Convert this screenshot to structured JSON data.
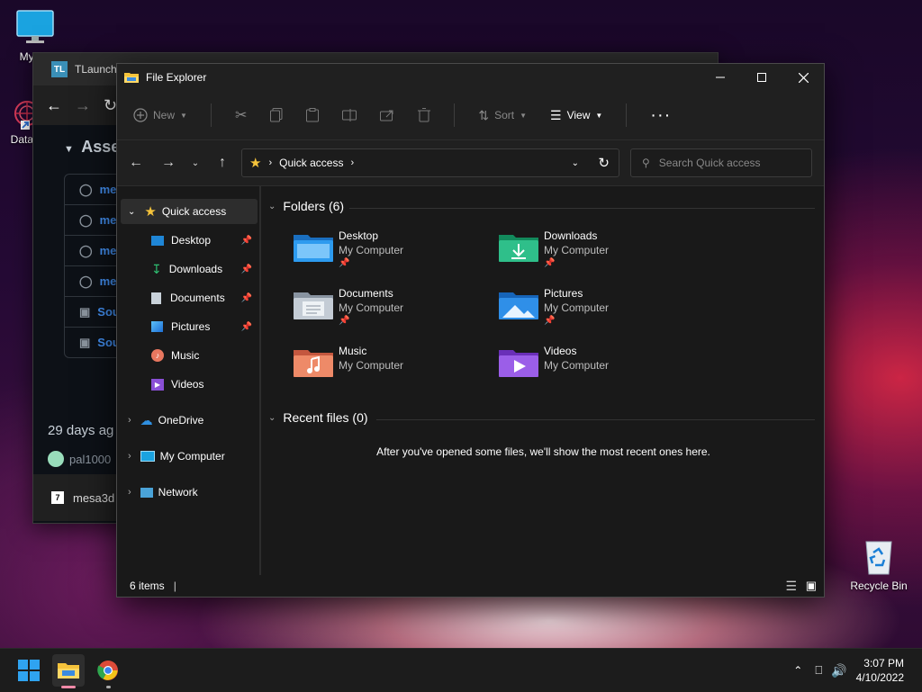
{
  "desktop": {
    "icons": [
      {
        "label": "My Co"
      },
      {
        "label": "DataW"
      },
      {
        "label": "Recycle Bin"
      }
    ]
  },
  "bg_window": {
    "title": "TLaunche",
    "section_title": "Asset",
    "list_items": [
      "me",
      "me",
      "me",
      "me",
      "Sou",
      "Sou"
    ],
    "time_ago": "29 days ag",
    "user": "pal1000",
    "footer_file": "mesa3d"
  },
  "explorer": {
    "title": "File Explorer",
    "toolbar": {
      "new": "New",
      "sort": "Sort",
      "view": "View"
    },
    "address": {
      "location": "Quick access"
    },
    "search": {
      "placeholder": "Search Quick access"
    },
    "sidebar": {
      "quick_access": "Quick access",
      "pinned": [
        "Desktop",
        "Downloads",
        "Documents",
        "Pictures",
        "Music",
        "Videos"
      ],
      "onedrive": "OneDrive",
      "my_computer": "My Computer",
      "network": "Network"
    },
    "folders_header": "Folders (6)",
    "folders": [
      {
        "name": "Desktop",
        "location": "My Computer"
      },
      {
        "name": "Downloads",
        "location": "My Computer"
      },
      {
        "name": "Documents",
        "location": "My Computer"
      },
      {
        "name": "Pictures",
        "location": "My Computer"
      },
      {
        "name": "Music",
        "location": "My Computer"
      },
      {
        "name": "Videos",
        "location": "My Computer"
      }
    ],
    "recent_header": "Recent files (0)",
    "recent_empty": "After you've opened some files, we'll show the most recent ones here.",
    "status": "6 items"
  },
  "taskbar": {
    "time": "3:07 PM",
    "date": "4/10/2022"
  },
  "colors": {
    "accent": "#0078d4",
    "window_bg": "#191919",
    "toolbar_bg": "#202020"
  }
}
